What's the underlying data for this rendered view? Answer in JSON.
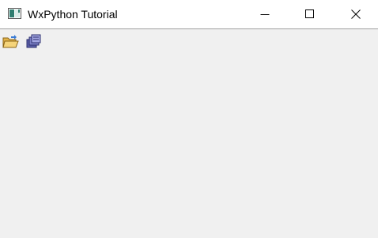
{
  "window": {
    "title": "WxPython Tutorial",
    "app_icon": "window-app-icon",
    "controls": {
      "minimize_icon": "minimize-icon",
      "maximize_icon": "maximize-icon",
      "close_icon": "close-icon"
    }
  },
  "toolbar": {
    "tools": [
      {
        "icon": "open-folder-icon"
      },
      {
        "icon": "exit-app-icon"
      }
    ]
  },
  "colors": {
    "client_background": "#f0f0f0",
    "titlebar_background": "#ffffff",
    "titlebar_border": "#a0a0a0"
  }
}
